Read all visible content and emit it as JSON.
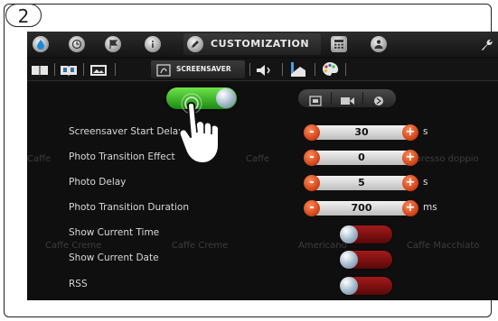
{
  "step_number": "2",
  "top_nav": {
    "items": [
      {
        "name": "water-drop-icon"
      },
      {
        "name": "clock-icon"
      },
      {
        "name": "flag-icon"
      },
      {
        "name": "info-icon"
      },
      {
        "name": "customization-icon",
        "label": "CUSTOMIZATION",
        "active": true
      },
      {
        "name": "calculator-icon"
      },
      {
        "name": "user-lock-icon"
      },
      {
        "name": "wrench-icon"
      }
    ]
  },
  "sub_nav": {
    "items": [
      {
        "name": "book-icon"
      },
      {
        "name": "book-image-icon"
      },
      {
        "name": "picture-frame-icon"
      },
      {
        "name": "screensaver-icon",
        "label": "SCREENSAVER",
        "active": true
      },
      {
        "name": "speaker-icon"
      },
      {
        "name": "cup-icon"
      },
      {
        "name": "palette-icon"
      }
    ]
  },
  "screensaver_enabled": true,
  "mode_buttons": [
    {
      "name": "image-mode-icon"
    },
    {
      "name": "video-mode-icon"
    },
    {
      "name": "disabled-mode-icon"
    }
  ],
  "settings": [
    {
      "label": "Screensaver Start Delay",
      "value": "30",
      "unit": "s"
    },
    {
      "label": "Photo Transition Effect",
      "value": "0",
      "unit": ""
    },
    {
      "label": "Photo Delay",
      "value": "5",
      "unit": "s"
    },
    {
      "label": "Photo Transition Duration",
      "value": "700",
      "unit": "ms"
    }
  ],
  "toggles": [
    {
      "label": "Show Current Time",
      "on": false
    },
    {
      "label": "Show Current Date",
      "on": false
    },
    {
      "label": "RSS",
      "on": false
    }
  ],
  "background_labels": [
    "Caffe Creme",
    "Caffe Creme",
    "Americano",
    "Caffe Macchiato",
    "Caffe",
    "Caffe",
    "Espresso doppio"
  ],
  "colors": {
    "accent_minus_plus": "#e0521f",
    "toggle_on": "#3fbf2a",
    "toggle_off": "#8a1010",
    "screen_bg": "#0f0f0f"
  }
}
